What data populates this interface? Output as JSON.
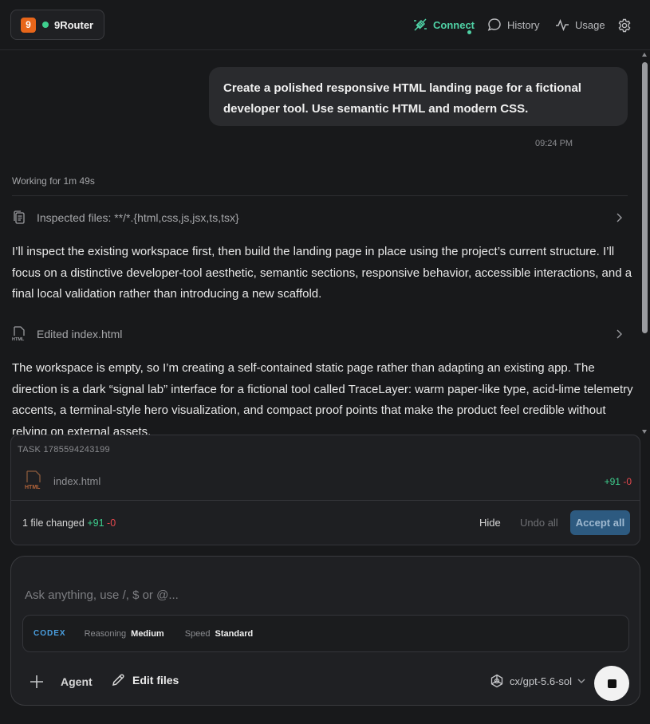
{
  "header": {
    "brand_logo": "9",
    "brand_name": "9Router",
    "nav": {
      "connect": "Connect",
      "history": "History",
      "usage": "Usage"
    },
    "settings_icon": "gear-icon"
  },
  "conversation": {
    "user_message": "Create a polished responsive HTML landing page for a fictional developer tool. Use semantic HTML and modern CSS.",
    "user_time": "09:24 PM",
    "working_status": "Working for 1m 49s",
    "inspect_action": "Inspected files: **/*.{html,css,js,jsx,ts,tsx}",
    "paragraph_1": "I’ll inspect the existing workspace first, then build the landing page in place using the project’s current structure. I’ll focus on a distinctive developer-tool aesthetic, semantic sections, responsive behavior, accessible interactions, and a final local validation rather than introducing a new scaffold.",
    "edit_action": "Edited index.html",
    "paragraph_2": "The workspace is empty, so I’m creating a self-contained static page rather than adapting an existing app. The direction is a dark “signal lab” interface for a fictional tool called TraceLayer: warm paper-like type, acid-lime telemetry accents, a terminal-style hero visualization, and compact proof points that make the product feel credible without relying on external assets."
  },
  "task": {
    "id_label": "TASK 1785594243199",
    "file_icon_label": "HTML",
    "file_name": "index.html",
    "file_added": "+91",
    "file_removed": "-0",
    "summary": "1 file changed",
    "summary_added": "+91",
    "summary_removed": "-0",
    "hide_label": "Hide",
    "undo_label": "Undo all",
    "accept_label": "Accept all"
  },
  "composer": {
    "placeholder": "Ask anything, use /, $ or @...",
    "engine": "CODEX",
    "reasoning_label": "Reasoning",
    "reasoning_value": "Medium",
    "speed_label": "Speed",
    "speed_value": "Standard",
    "agent_label": "Agent",
    "edit_files_label": "Edit files",
    "model": "cx/gpt-5.6-sol"
  },
  "colors": {
    "accent_green": "#4fd1a5",
    "brand_orange": "#e8661a",
    "diff_added": "#3ecf8e",
    "diff_removed": "#e5484d",
    "accept_button": "#2d5a80"
  }
}
